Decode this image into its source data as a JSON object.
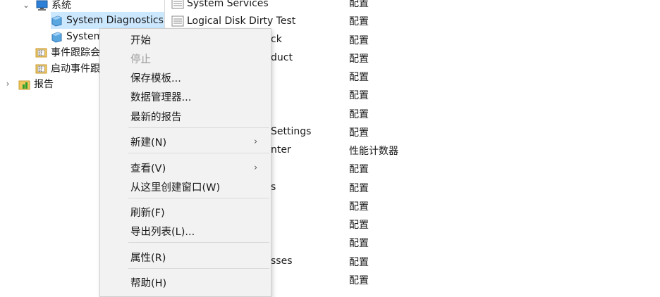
{
  "tree": {
    "system": "系统",
    "system_diagnostics": "System Diagnostics",
    "system_performance": "System Performance",
    "event_trace": "事件跟踪会话",
    "startup_event": "启动事件跟踪会话",
    "reports": "报告"
  },
  "list": {
    "rows": [
      {
        "name": "System Services",
        "type": "配置"
      },
      {
        "name": "Logical Disk Dirty Test",
        "type": "配置"
      },
      {
        "name": "ck",
        "type": "配置"
      },
      {
        "name": "duct",
        "type": "配置"
      },
      {
        "name": "",
        "type": "配置"
      },
      {
        "name": "",
        "type": "配置"
      },
      {
        "name": "",
        "type": "配置"
      },
      {
        "name": "Settings",
        "type": "配置"
      },
      {
        "name": "nter",
        "type": "性能计数器"
      },
      {
        "name": "",
        "type": "配置"
      },
      {
        "name": "s",
        "type": "配置"
      },
      {
        "name": "",
        "type": "配置"
      },
      {
        "name": "",
        "type": "配置"
      },
      {
        "name": "",
        "type": "配置"
      },
      {
        "name": "sses",
        "type": "配置"
      },
      {
        "name": "",
        "type": "配置"
      }
    ]
  },
  "menu": {
    "start": "开始",
    "stop": "停止",
    "save_template": "保存模板...",
    "data_manager": "数据管理器...",
    "latest_report": "最新的报告",
    "new": "新建(N)",
    "view": "查看(V)",
    "new_window": "从这里创建窗口(W)",
    "refresh": "刷新(F)",
    "export_list": "导出列表(L)...",
    "properties": "属性(R)",
    "help": "帮助(H)",
    "submenu_glyph": "›"
  }
}
